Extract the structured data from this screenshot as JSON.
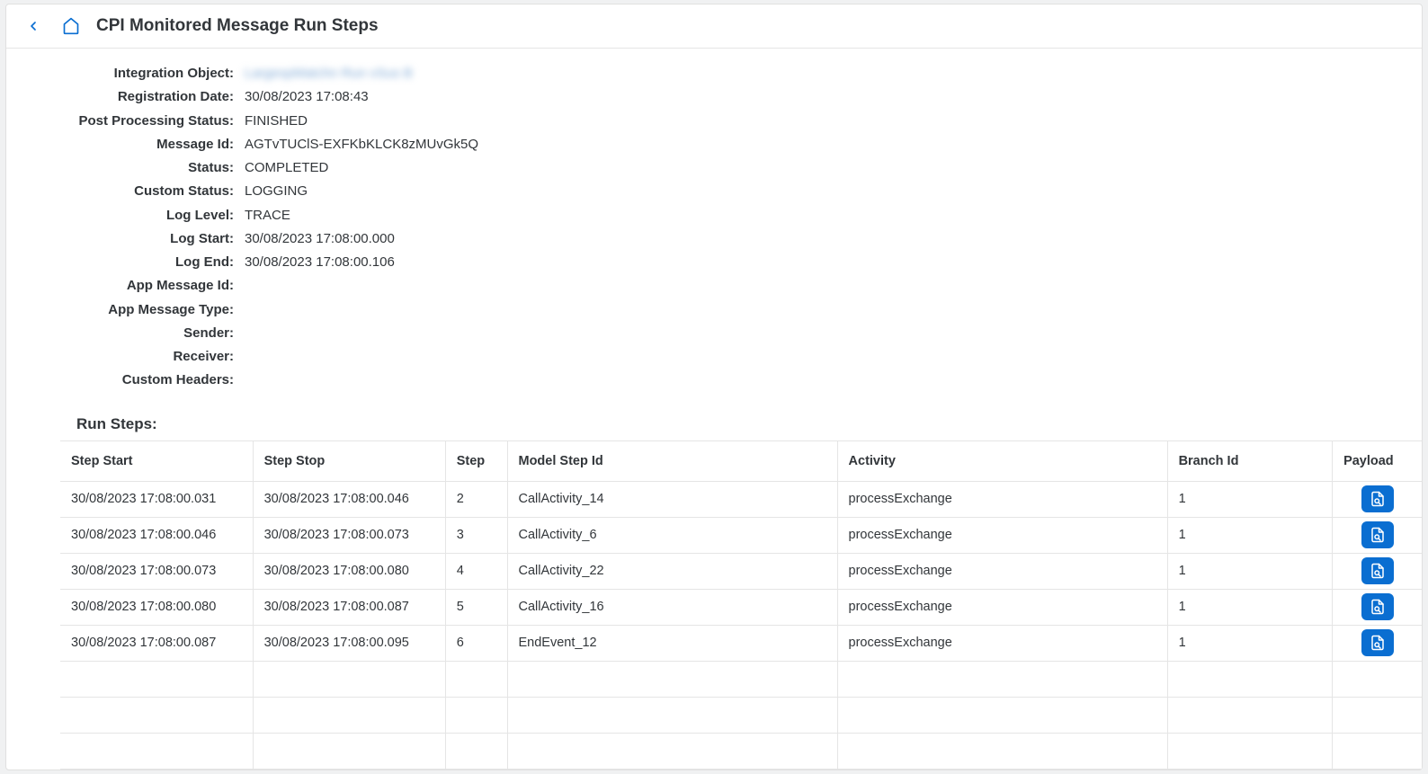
{
  "header": {
    "title": "CPI Monitored Message Run Steps"
  },
  "details": {
    "labels": {
      "integrationObject": "Integration Object:",
      "registrationDate": "Registration Date:",
      "postProcessingStatus": "Post Processing Status:",
      "messageId": "Message Id:",
      "status": "Status:",
      "customStatus": "Custom Status:",
      "logLevel": "Log Level:",
      "logStart": "Log Start:",
      "logEnd": "Log End:",
      "appMessageId": "App Message Id:",
      "appMessageType": "App Message Type:",
      "sender": "Sender:",
      "receiver": "Receiver:",
      "customHeaders": "Custom Headers:"
    },
    "values": {
      "integrationObject": "LargespMatchn Run vSus B",
      "registrationDate": "30/08/2023 17:08:43",
      "postProcessingStatus": "FINISHED",
      "messageId": "AGTvTUClS-EXFKbKLCK8zMUvGk5Q",
      "status": "COMPLETED",
      "customStatus": "LOGGING",
      "logLevel": "TRACE",
      "logStart": "30/08/2023 17:08:00.000",
      "logEnd": "30/08/2023 17:08:00.106",
      "appMessageId": "",
      "appMessageType": "",
      "sender": "",
      "receiver": "",
      "customHeaders": ""
    }
  },
  "runSteps": {
    "title": "Run Steps:",
    "columns": {
      "stepStart": "Step Start",
      "stepStop": "Step Stop",
      "step": "Step",
      "modelStepId": "Model Step Id",
      "activity": "Activity",
      "branchId": "Branch Id",
      "payload": "Payload"
    },
    "rows": [
      {
        "stepStart": "30/08/2023 17:08:00.031",
        "stepStop": "30/08/2023 17:08:00.046",
        "step": "2",
        "modelStepId": "CallActivity_14",
        "activity": "processExchange",
        "branchId": "1"
      },
      {
        "stepStart": "30/08/2023 17:08:00.046",
        "stepStop": "30/08/2023 17:08:00.073",
        "step": "3",
        "modelStepId": "CallActivity_6",
        "activity": "processExchange",
        "branchId": "1"
      },
      {
        "stepStart": "30/08/2023 17:08:00.073",
        "stepStop": "30/08/2023 17:08:00.080",
        "step": "4",
        "modelStepId": "CallActivity_22",
        "activity": "processExchange",
        "branchId": "1"
      },
      {
        "stepStart": "30/08/2023 17:08:00.080",
        "stepStop": "30/08/2023 17:08:00.087",
        "step": "5",
        "modelStepId": "CallActivity_16",
        "activity": "processExchange",
        "branchId": "1"
      },
      {
        "stepStart": "30/08/2023 17:08:00.087",
        "stepStop": "30/08/2023 17:08:00.095",
        "step": "6",
        "modelStepId": "EndEvent_12",
        "activity": "processExchange",
        "branchId": "1"
      }
    ],
    "emptyRows": 3
  }
}
